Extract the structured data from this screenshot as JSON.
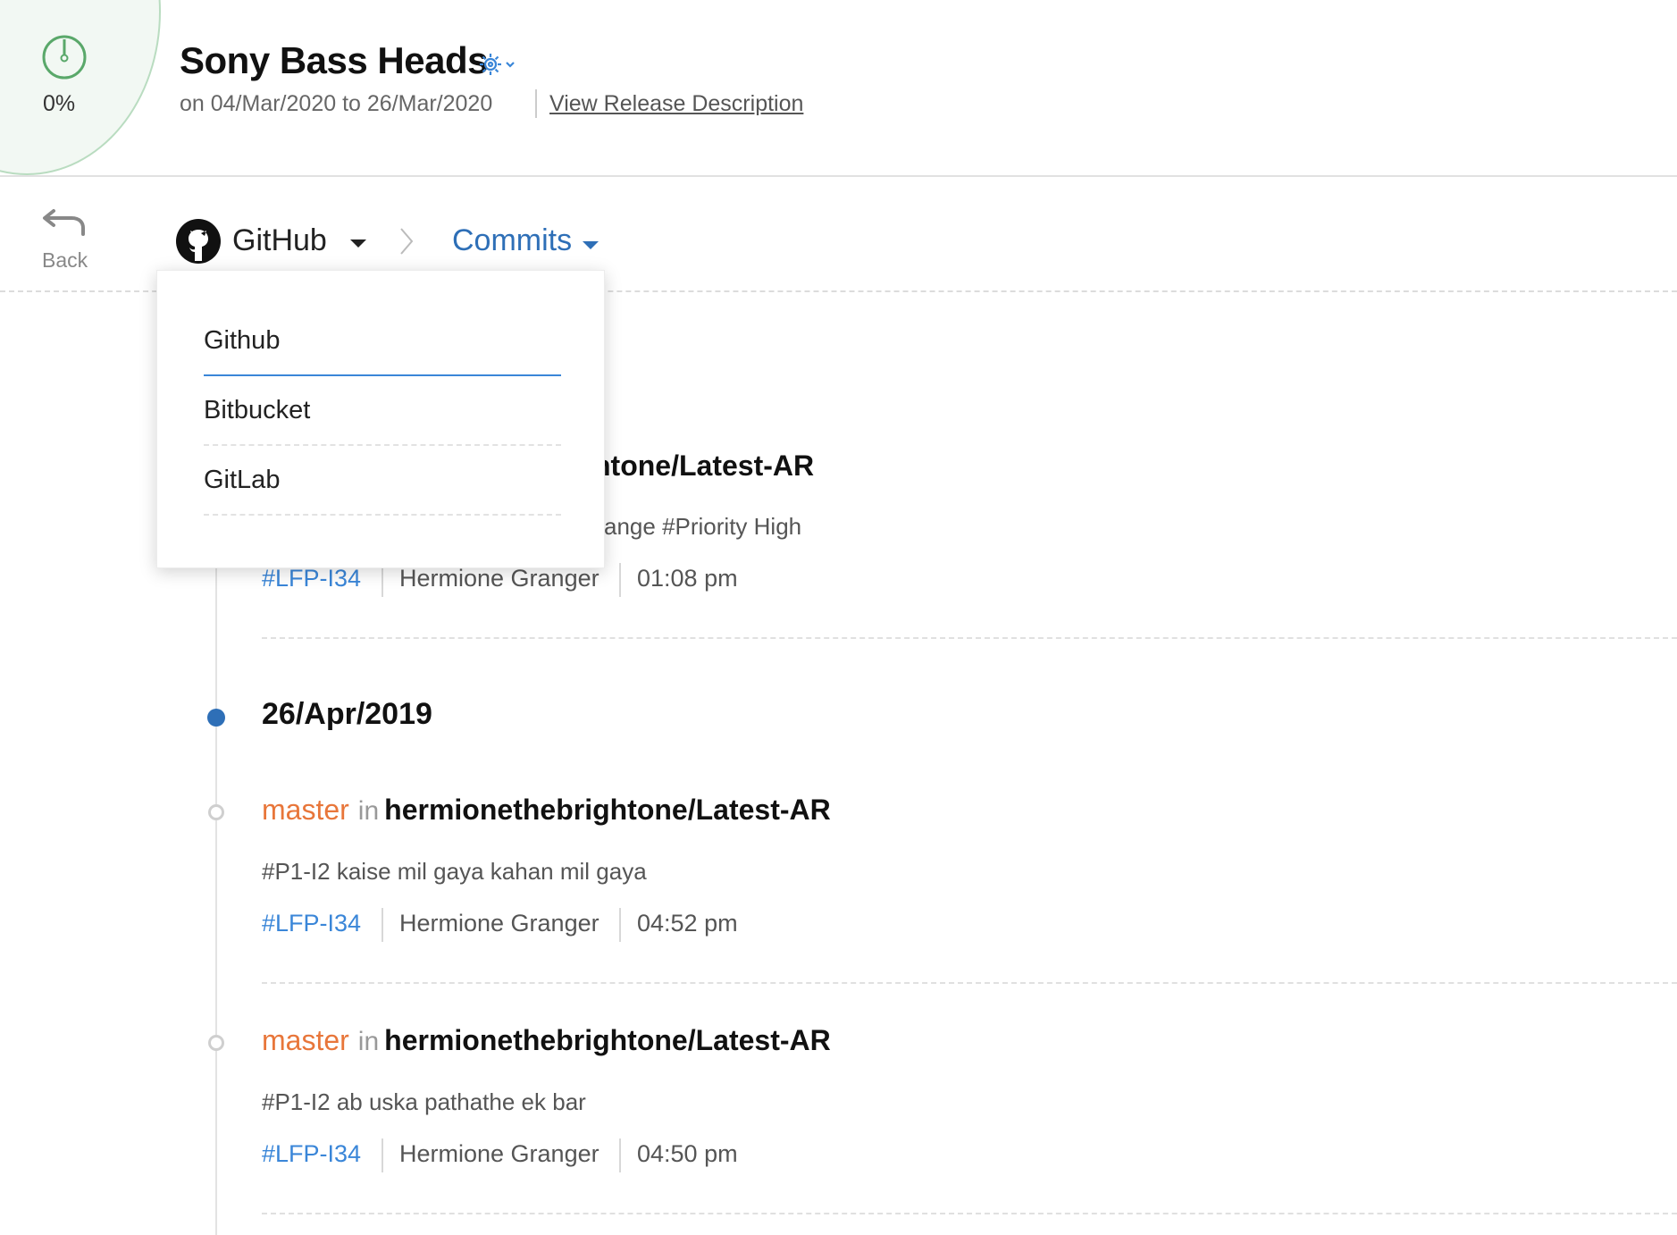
{
  "header": {
    "progress_percent": "0%",
    "progress_value": 0,
    "title": "Sony Bass Heads",
    "dates": "on 04/Mar/2020 to 26/Mar/2020",
    "release_link": "View Release Description",
    "icons": {
      "progress": "timer-icon",
      "settings": "gear-icon"
    }
  },
  "toolbar": {
    "back_label": "Back",
    "provider": "GitHub",
    "view": "Commits",
    "icons": {
      "back": "undo-arrow-icon",
      "provider": "github-icon",
      "separator": "chevron-right-icon"
    }
  },
  "dropdown": {
    "options": [
      "Github",
      "Bitbucket",
      "GitLab"
    ],
    "selected": "Github"
  },
  "commits_top": {
    "repo_partial": "htone/Latest-AR",
    "message_partial": "ange #Priority High",
    "issue": "#LFP-I34",
    "author": "Hermione Granger",
    "time": "01:08 pm"
  },
  "date_group": {
    "date": "26/Apr/2019",
    "commits": [
      {
        "branch": "master",
        "in": "in",
        "repo": "hermionethebrightone/Latest-AR",
        "message": "#P1-I2 kaise mil gaya kahan mil gaya",
        "issue": "#LFP-I34",
        "author": "Hermione Granger",
        "time": "04:52 pm"
      },
      {
        "branch": "master",
        "in": "in",
        "repo": "hermionethebrightone/Latest-AR",
        "message": "#P1-I2 ab uska pathathe ek bar",
        "issue": "#LFP-I34",
        "author": "Hermione Granger",
        "time": "04:50 pm"
      }
    ]
  },
  "colors": {
    "accent": "#2e6fb7",
    "link": "#3a86d8",
    "branch": "#e8763a",
    "progress_bg": "#f2f8f3",
    "progress_border": "#b9dcc0"
  }
}
